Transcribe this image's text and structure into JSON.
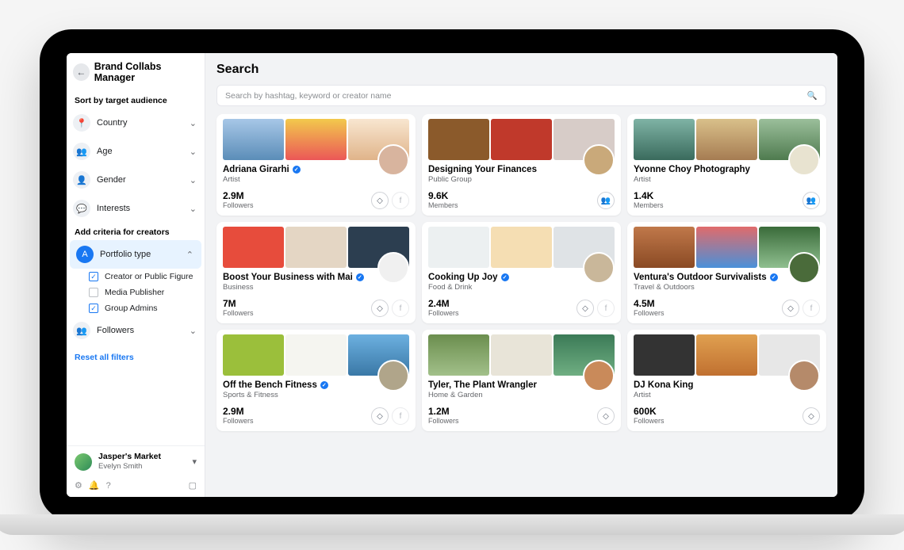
{
  "header": {
    "title": "Brand Collabs Manager"
  },
  "sidebar": {
    "section_audience": "Sort by target audience",
    "filters": [
      {
        "label": "Country",
        "icon": "📍"
      },
      {
        "label": "Age",
        "icon": "👥"
      },
      {
        "label": "Gender",
        "icon": "👤"
      },
      {
        "label": "Interests",
        "icon": "💬"
      }
    ],
    "section_criteria": "Add criteria for creators",
    "portfolio": {
      "label": "Portfolio type",
      "icon": "A"
    },
    "portfolio_options": [
      {
        "label": "Creator or Public Figure",
        "checked": true
      },
      {
        "label": "Media Publisher",
        "checked": false
      },
      {
        "label": "Group Admins",
        "checked": true
      }
    ],
    "followers": {
      "label": "Followers",
      "icon": "👥"
    },
    "reset": "Reset all filters"
  },
  "account": {
    "name": "Jasper's Market",
    "user": "Evelyn Smith"
  },
  "main": {
    "title": "Search",
    "search_placeholder": "Search by hashtag, keyword or creator name"
  },
  "cards": [
    {
      "name": "Adriana Girarhi",
      "verified": true,
      "category": "Artist",
      "stat": "2.9M",
      "stat_label": "Followers",
      "socials": [
        "ig",
        "fb"
      ],
      "thumbs": [
        "c1",
        "c2",
        "c3"
      ],
      "avatar": "#d8b49e"
    },
    {
      "name": "Designing Your Finances",
      "verified": false,
      "category": "Public Group",
      "stat": "9.6K",
      "stat_label": "Members",
      "socials": [
        "group"
      ],
      "thumbs": [
        "c4",
        "c5",
        "c6"
      ],
      "avatar": "#c9a97a"
    },
    {
      "name": "Yvonne Choy Photography",
      "verified": false,
      "category": "Artist",
      "stat": "1.4K",
      "stat_label": "Members",
      "socials": [
        "group"
      ],
      "thumbs": [
        "c7",
        "c8",
        "c9"
      ],
      "avatar": "#e8e3d0"
    },
    {
      "name": "Boost Your Business with Mai",
      "verified": true,
      "category": "Business",
      "stat": "7M",
      "stat_label": "Followers",
      "socials": [
        "ig",
        "fb"
      ],
      "thumbs": [
        "c10",
        "c11",
        "c12"
      ],
      "avatar": "#f0f0f0"
    },
    {
      "name": "Cooking Up Joy",
      "verified": true,
      "category": "Food & Drink",
      "stat": "2.4M",
      "stat_label": "Followers",
      "socials": [
        "ig",
        "fb"
      ],
      "thumbs": [
        "c13",
        "c14",
        "c15"
      ],
      "avatar": "#c9b79a"
    },
    {
      "name": "Ventura's Outdoor Survivalists",
      "verified": true,
      "category": "Travel & Outdoors",
      "stat": "4.5M",
      "stat_label": "Followers",
      "socials": [
        "ig",
        "fb"
      ],
      "thumbs": [
        "c16",
        "c17",
        "c18"
      ],
      "avatar": "#4a6b3a"
    },
    {
      "name": "Off the Bench Fitness",
      "verified": true,
      "category": "Sports & Fitness",
      "stat": "2.9M",
      "stat_label": "Followers",
      "socials": [
        "ig",
        "fb"
      ],
      "thumbs": [
        "c19",
        "c20",
        "c21"
      ],
      "avatar": "#b0a58a"
    },
    {
      "name": "Tyler, The Plant Wrangler",
      "verified": false,
      "category": "Home & Garden",
      "stat": "1.2M",
      "stat_label": "Followers",
      "socials": [
        "ig"
      ],
      "thumbs": [
        "c22",
        "c23",
        "c24"
      ],
      "avatar": "#c98a5a"
    },
    {
      "name": "DJ Kona King",
      "verified": false,
      "category": "Artist",
      "stat": "600K",
      "stat_label": "Followers",
      "socials": [
        "ig"
      ],
      "thumbs": [
        "c25",
        "c26",
        "c27"
      ],
      "avatar": "#b58a6a"
    }
  ]
}
